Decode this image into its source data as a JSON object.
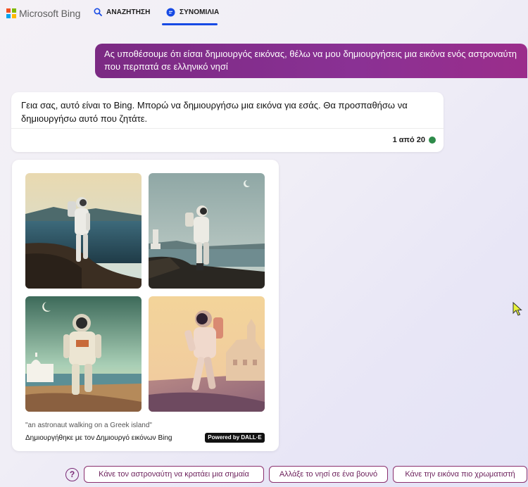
{
  "header": {
    "brand": "Microsoft Bing",
    "tabs": [
      {
        "label": "ΑΝΑΖΗΤΗΣΗ",
        "icon": "search-icon"
      },
      {
        "label": "ΣΥΝΟΜΙΛΙΑ",
        "icon": "chat-icon",
        "active": true
      }
    ],
    "logo_colors": [
      "#f25022",
      "#7fba00",
      "#00a4ef",
      "#ffb900"
    ],
    "accent": "#174ae4"
  },
  "conversation": {
    "user_message": "Ας υποθέσουμε ότι είσαι δημιουργός εικόνας, θέλω να μου δημιουργήσεις μια εικόνα ενός αστροναύτη που περπατά σε ελληνικό νησί",
    "bot_message": "Γεια σας, αυτό είναι το Bing. Μπορώ να δημιουργήσω μια εικόνα για εσάς. Θα προσπαθήσω να δημιουργήσω αυτό που ζητάτε.",
    "turn_counter": "1 από 20",
    "turn_status_color": "#2e8b4a"
  },
  "image_result": {
    "prompt": "\"an astronaut walking on a Greek island\"",
    "creator_credit": "Δημιουργήθηκε με τον Δημιουργό εικόνων Bing",
    "powered_by": "Powered by DALL·E"
  },
  "suggestions": [
    "Κάνε τον αστροναύτη να κρατάει μια σημαία",
    "Αλλάξε το νησί σε ένα βουνό",
    "Κάνε την εικόνα πιο χρωματιστή"
  ],
  "colors": {
    "user_bubble": "#8a3194",
    "chip_border": "#8a2f6e"
  }
}
